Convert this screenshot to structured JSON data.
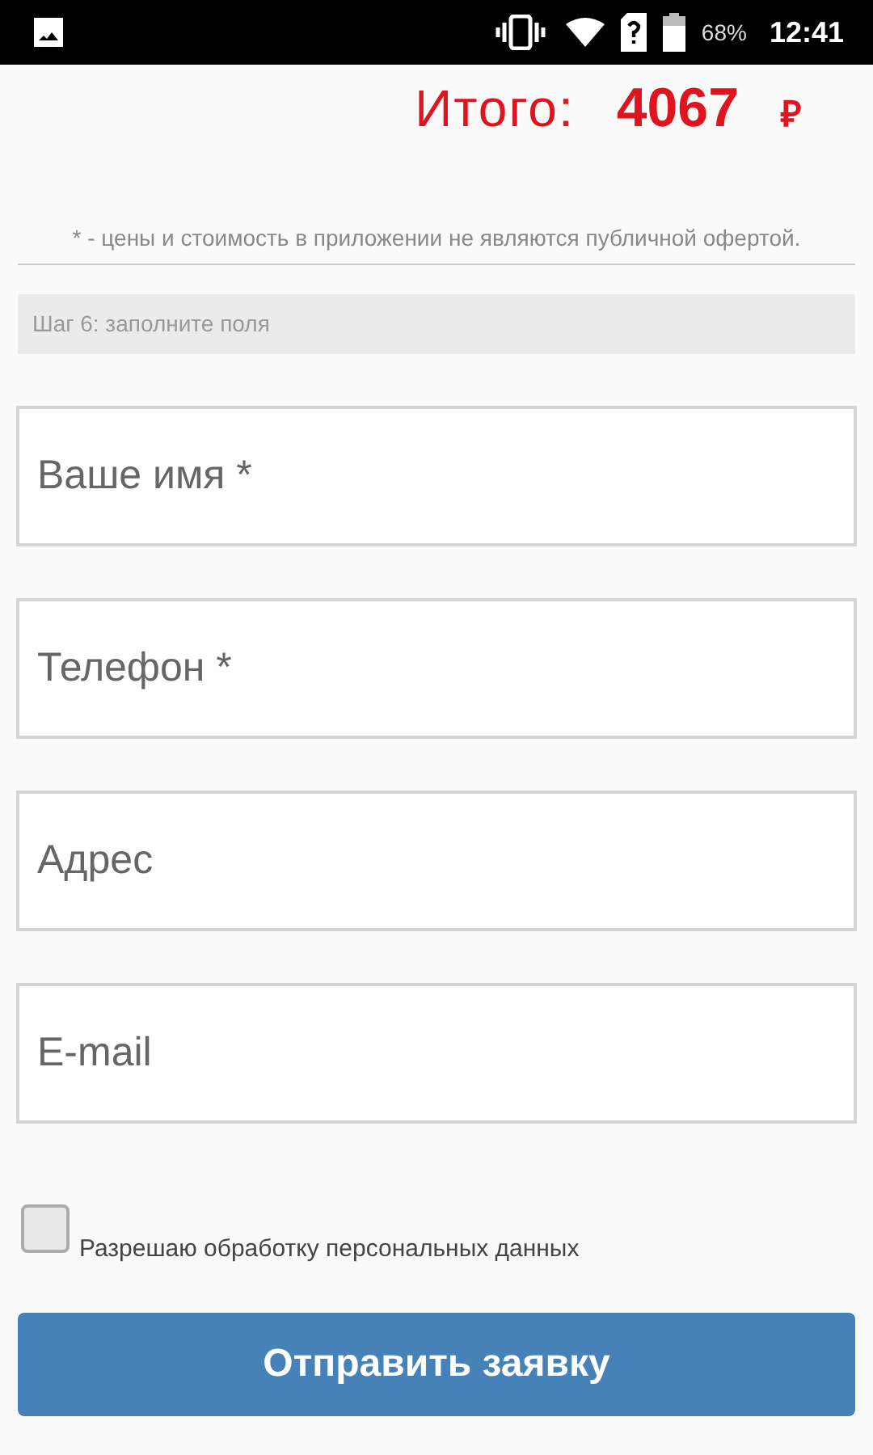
{
  "status_bar": {
    "battery": "68%",
    "time": "12:41"
  },
  "total": {
    "label": "Итого:",
    "amount": "4067",
    "currency": "₽"
  },
  "disclaimer": "* - цены и стоимость в приложении не являются публичной офертой.",
  "step": "Шаг 6: заполните поля",
  "fields": [
    {
      "placeholder": "Ваше имя *"
    },
    {
      "placeholder": "Телефон *"
    },
    {
      "placeholder": "Адрес"
    },
    {
      "placeholder": "E-mail"
    }
  ],
  "consent": {
    "label": "Разрешаю обработку персональных данных",
    "checked": false
  },
  "submit": "Отправить заявку"
}
